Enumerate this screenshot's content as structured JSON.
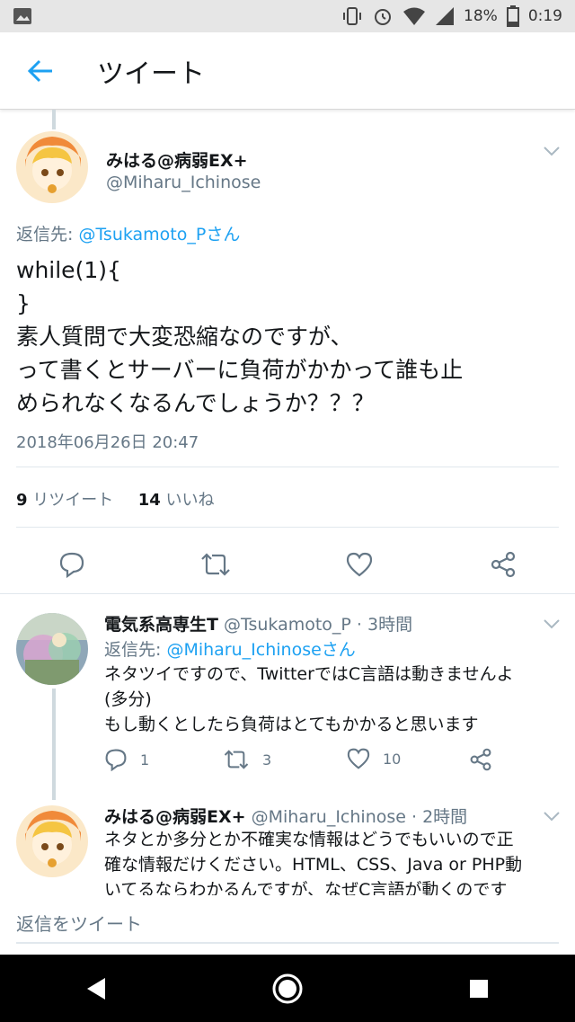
{
  "status": {
    "battery": "18%",
    "time": "0:19"
  },
  "header": {
    "title": "ツイート"
  },
  "main_tweet": {
    "name": "みはる@病弱EX+",
    "handle": "@Miharu_Ichinose",
    "reply_prefix": "返信先: ",
    "reply_to": "@Tsukamoto_Pさん",
    "text": "while(1){\n}\n素人質問で大変恐縮なのですが、\nって書くとサーバーに負荷がかかって誰も止\nめられなくなるんでしょうか？？？",
    "timestamp": "2018年06月26日 20:47",
    "retweet_count": "9",
    "retweet_label": "リツイート",
    "like_count": "14",
    "like_label": "いいね"
  },
  "replies": [
    {
      "name": "電気系高専生T",
      "handle": "@Tsukamoto_P · 3時間",
      "reply_prefix": "返信先: ",
      "reply_to": "@Miharu_Ichinoseさん",
      "text": "ネタツイですので、TwitterではC言語は動きませんよ\n(多分)\nもし動くとしたら負荷はとてもかかると思います",
      "reply_count": "1",
      "retweet_count": "3",
      "like_count": "10"
    },
    {
      "name": "みはる@病弱EX+",
      "handle": "@Miharu_Ichinose · 2時間",
      "text": "ネタとか多分とか不確実な情報はどうでもいいので正\n確な情報だけください。HTML、CSS、Java or PHP動\nいてるならわかるんですが、なぜC言語が動くのです"
    }
  ],
  "compose": {
    "placeholder": "返信をツイート"
  },
  "colors": {
    "accent": "#1da1f2",
    "muted": "#657786"
  }
}
